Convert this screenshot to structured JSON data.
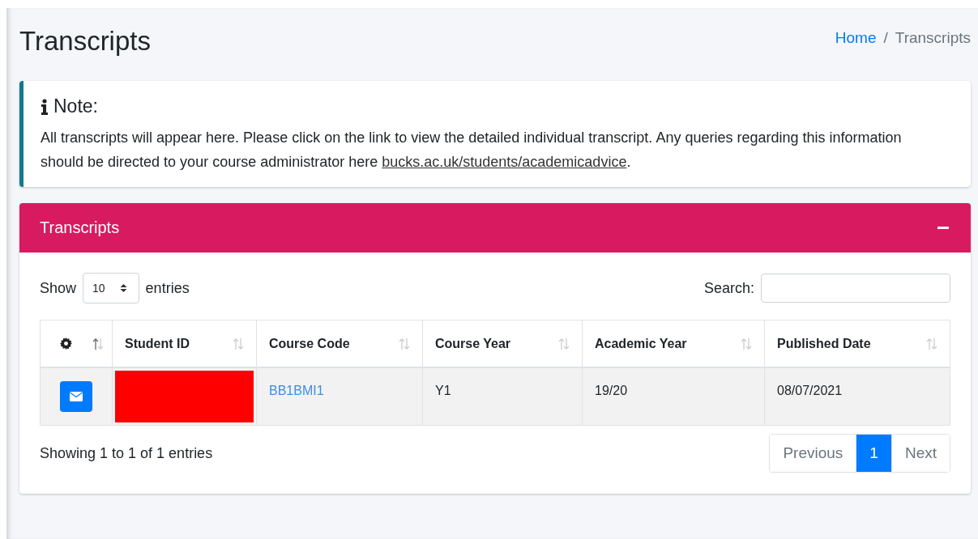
{
  "page_title": "Transcripts",
  "breadcrumb_separator": "/",
  "breadcrumb": [
    {
      "label": "Home",
      "kind": "link"
    },
    {
      "label": "Transcripts",
      "kind": "current"
    }
  ],
  "note": {
    "title": "Note:",
    "text": "All transcripts will appear here. Please click on the link to view the detailed individual transcript. Any queries regarding this information should be directed to your course administrator here ",
    "link": "bucks.ac.uk/students/academicadvice",
    "after": "."
  },
  "card": {
    "title": "Transcripts",
    "expanded": true,
    "length": {
      "before": "Show",
      "value": "10",
      "after": "entries"
    },
    "search": {
      "label": "Search:"
    },
    "columns": [
      {
        "kind": "icon",
        "sorted": true
      },
      {
        "kind": "text",
        "label": "Student ID",
        "sorted": false
      },
      {
        "kind": "text",
        "label": "Course Code",
        "sorted": false
      },
      {
        "kind": "text",
        "label": "Course Year",
        "sorted": false
      },
      {
        "kind": "text",
        "label": "Academic Year",
        "sorted": false
      },
      {
        "kind": "text",
        "label": "Published Date",
        "sorted": false
      }
    ],
    "rows": [
      {
        "student_id_redacted": true,
        "course_code": "BB1BMI1",
        "course_year": "Y1",
        "academic_year": "19/20",
        "published_date": "08/07/2021"
      }
    ],
    "info": "Showing 1 to 1 of 1 entries",
    "pagination": [
      {
        "label": "Previous",
        "selected": false
      },
      {
        "label": "1",
        "selected": true
      },
      {
        "label": "Next",
        "selected": false
      }
    ]
  }
}
